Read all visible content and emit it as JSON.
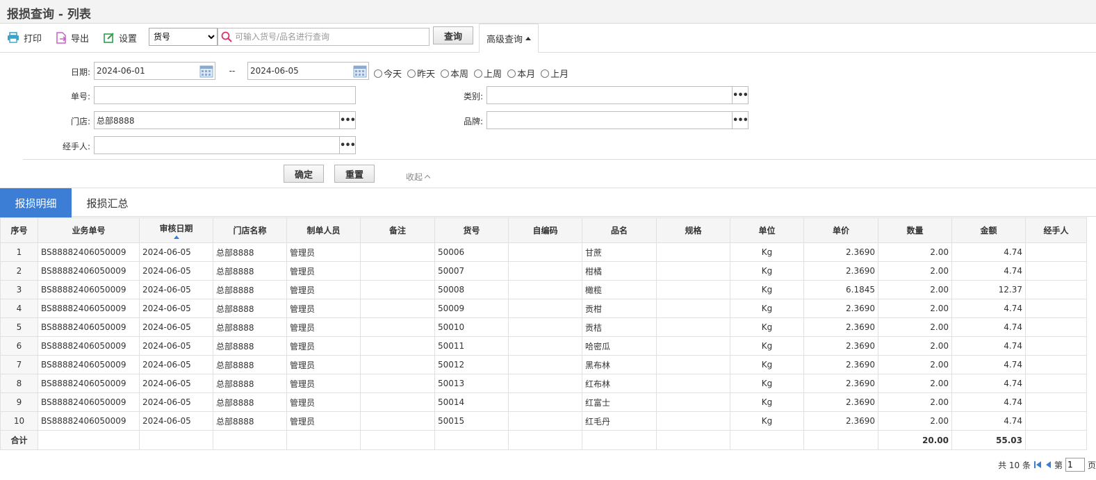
{
  "page": {
    "title": "报损查询 - 列表"
  },
  "toolbar": {
    "print_label": "打印",
    "export_label": "导出",
    "settings_label": "设置",
    "search_field": {
      "selected": "货号",
      "options": [
        "货号"
      ]
    },
    "search_placeholder": "可输入货号/品名进行查询",
    "query_label": "查询",
    "advanced_label": "高级查询"
  },
  "filters": {
    "date_label": "日期:",
    "date_from": "2024-06-01",
    "date_sep": "--",
    "date_to": "2024-06-05",
    "quick_ranges": [
      "今天",
      "昨天",
      "本周",
      "上周",
      "本月",
      "上月"
    ],
    "order_no_label": "单号:",
    "order_no": "",
    "category_label": "类别:",
    "category": "",
    "store_label": "门店:",
    "store": "总部8888",
    "brand_label": "品牌:",
    "brand": "",
    "handler_label": "经手人:",
    "handler": "",
    "confirm_label": "确定",
    "reset_label": "重置",
    "collapse_label": "收起"
  },
  "tabs": [
    {
      "label": "报损明细",
      "active": true
    },
    {
      "label": "报损汇总",
      "active": false
    }
  ],
  "table": {
    "columns": [
      "序号",
      "业务单号",
      "审核日期",
      "门店名称",
      "制单人员",
      "备注",
      "货号",
      "自编码",
      "品名",
      "规格",
      "单位",
      "单价",
      "数量",
      "金额",
      "经手人"
    ],
    "rows": [
      [
        "1",
        "BS88882406050009",
        "2024-06-05",
        "总部8888",
        "管理员",
        "",
        "50006",
        "",
        "甘蔗",
        "",
        "Kg",
        "2.3690",
        "2.00",
        "4.74",
        ""
      ],
      [
        "2",
        "BS88882406050009",
        "2024-06-05",
        "总部8888",
        "管理员",
        "",
        "50007",
        "",
        "柑橘",
        "",
        "Kg",
        "2.3690",
        "2.00",
        "4.74",
        ""
      ],
      [
        "3",
        "BS88882406050009",
        "2024-06-05",
        "总部8888",
        "管理员",
        "",
        "50008",
        "",
        "橄榄",
        "",
        "Kg",
        "6.1845",
        "2.00",
        "12.37",
        ""
      ],
      [
        "4",
        "BS88882406050009",
        "2024-06-05",
        "总部8888",
        "管理员",
        "",
        "50009",
        "",
        "贡柑",
        "",
        "Kg",
        "2.3690",
        "2.00",
        "4.74",
        ""
      ],
      [
        "5",
        "BS88882406050009",
        "2024-06-05",
        "总部8888",
        "管理员",
        "",
        "50010",
        "",
        "贡桔",
        "",
        "Kg",
        "2.3690",
        "2.00",
        "4.74",
        ""
      ],
      [
        "6",
        "BS88882406050009",
        "2024-06-05",
        "总部8888",
        "管理员",
        "",
        "50011",
        "",
        "哈密瓜",
        "",
        "Kg",
        "2.3690",
        "2.00",
        "4.74",
        ""
      ],
      [
        "7",
        "BS88882406050009",
        "2024-06-05",
        "总部8888",
        "管理员",
        "",
        "50012",
        "",
        "黑布林",
        "",
        "Kg",
        "2.3690",
        "2.00",
        "4.74",
        ""
      ],
      [
        "8",
        "BS88882406050009",
        "2024-06-05",
        "总部8888",
        "管理员",
        "",
        "50013",
        "",
        "红布林",
        "",
        "Kg",
        "2.3690",
        "2.00",
        "4.74",
        ""
      ],
      [
        "9",
        "BS88882406050009",
        "2024-06-05",
        "总部8888",
        "管理员",
        "",
        "50014",
        "",
        "红富士",
        "",
        "Kg",
        "2.3690",
        "2.00",
        "4.74",
        ""
      ],
      [
        "10",
        "BS88882406050009",
        "2024-06-05",
        "总部8888",
        "管理员",
        "",
        "50015",
        "",
        "红毛丹",
        "",
        "Kg",
        "2.3690",
        "2.00",
        "4.74",
        ""
      ]
    ],
    "total": {
      "label": "合计",
      "quantity": "20.00",
      "amount": "55.03"
    }
  },
  "pager": {
    "total_text": "共 10 条",
    "page_prefix": "第",
    "page": "1",
    "page_suffix": "页"
  },
  "colors": {
    "accent": "#3c7ed6"
  }
}
